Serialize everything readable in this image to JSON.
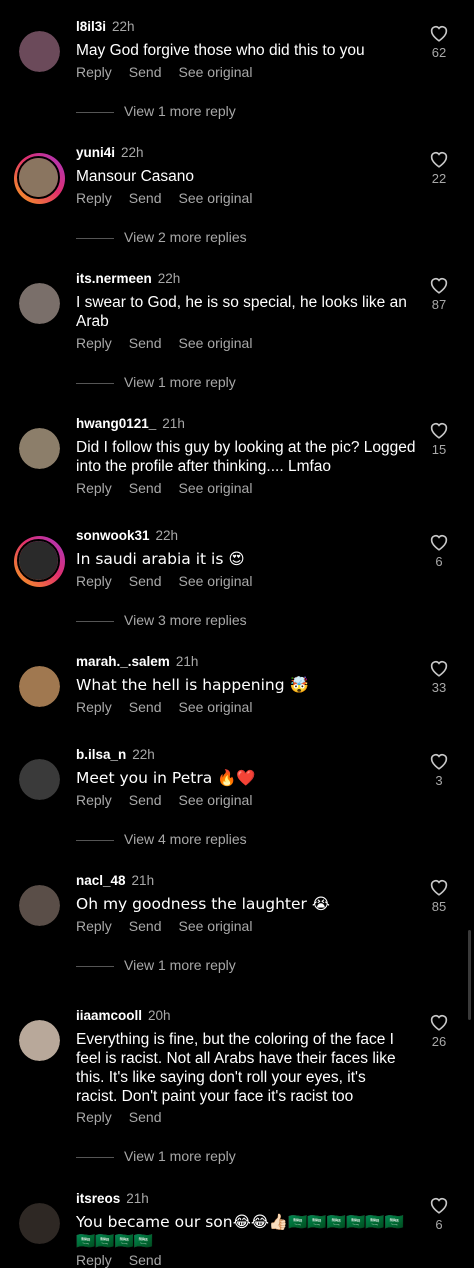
{
  "actions": {
    "reply": "Reply",
    "send": "Send",
    "see_original": "See original"
  },
  "comments": [
    {
      "username": "l8il3i",
      "time": "22h",
      "text": "May God forgive those who did this to you",
      "likes": "62",
      "more": "View 1 more reply",
      "avatar_color": "#6b4a5a"
    },
    {
      "username": "yuni4i",
      "time": "22h",
      "text": "Mansour Casano",
      "likes": "22",
      "more": "View 2 more replies",
      "avatar_color": "#8a7560"
    },
    {
      "username": "its.nermeen",
      "time": "22h",
      "text": "I swear to God, he is so special, he looks like an Arab",
      "likes": "87",
      "more": "View 1 more reply",
      "avatar_color": "#7a6f6a"
    },
    {
      "username": "hwang0121_",
      "time": "21h",
      "text": "Did I follow this guy by looking at the pic? Logged into the profile after thinking.... Lmfao",
      "likes": "15",
      "more": "",
      "avatar_color": "#8c7e6a"
    },
    {
      "username": "sonwook31",
      "time": "22h",
      "text": "In saudi arabia it is 😍",
      "likes": "6",
      "more": "View 3 more replies",
      "avatar_color": "#2a2a2a"
    },
    {
      "username": "marah._.salem",
      "time": "21h",
      "text": "What the hell is happening 🤯",
      "likes": "33",
      "more": "",
      "avatar_color": "#a07850"
    },
    {
      "username": "b.ilsa_n",
      "time": "22h",
      "text": "Meet you in Petra 🔥❤️",
      "likes": "3",
      "more": "View 4 more replies",
      "avatar_color": "#3a3a3a"
    },
    {
      "username": "nacl_48",
      "time": "21h",
      "text": "Oh my goodness the laughter 😭",
      "likes": "85",
      "more": "View 1 more reply",
      "avatar_color": "#5a4e48"
    },
    {
      "username": "iiaamcooll",
      "time": "20h",
      "text": "Everything is fine, but the coloring of the face I feel is racist. Not all Arabs have their faces like this. It's like saying don't roll your eyes, it's racist. Don't paint your face it's racist too",
      "likes": "26",
      "more": "View 1 more reply",
      "avatar_color": "#b8a89a"
    },
    {
      "username": "itsreos",
      "time": "21h",
      "text": "You became our son😂😂👍🏻🇸🇦🇸🇦🇸🇦🇸🇦🇸🇦🇸🇦🇸🇦🇸🇦🇸🇦🇸🇦",
      "likes": "6",
      "more": "",
      "avatar_color": "#2e2824"
    }
  ]
}
